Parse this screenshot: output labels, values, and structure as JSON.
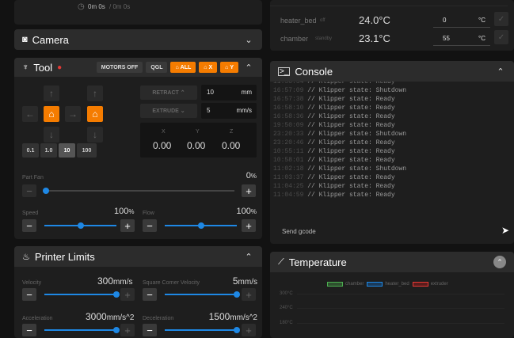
{
  "status": {
    "time": "0m 0s",
    "time_total": "/ 0m 0s"
  },
  "camera": {
    "title": "Camera"
  },
  "tool": {
    "title": "Tool",
    "motors_off": "MOTORS OFF",
    "qgl": "QGL",
    "home_all": "ALL",
    "home_x": "X",
    "home_y": "Y",
    "retract_label": "RETRACT",
    "extrude_label": "EXTRUDE",
    "retract_value": "10",
    "retract_unit": "mm",
    "extrude_value": "5",
    "extrude_unit": "mm/s",
    "axes": [
      {
        "label": "X",
        "value": "0.00"
      },
      {
        "label": "Y",
        "value": "0.00"
      },
      {
        "label": "Z",
        "value": "0.00"
      }
    ],
    "steps": [
      "0.1",
      "1.0",
      "10",
      "100"
    ],
    "active_step": "10",
    "part_fan_label": "Part Fan",
    "part_fan_value": "0",
    "part_fan_unit": "%",
    "speed_label": "Speed",
    "speed_value": "100",
    "speed_unit": "%",
    "flow_label": "Flow",
    "flow_value": "100",
    "flow_unit": "%",
    "part_fan_fraction": 0,
    "speed_fraction": 0.5,
    "flow_fraction": 0.5
  },
  "limits": {
    "title": "Printer Limits",
    "velocity_label": "Velocity",
    "velocity_value": "300",
    "velocity_unit": "mm/s",
    "scv_label": "Square Corner Velocity",
    "scv_value": "5",
    "scv_unit": "mm/s",
    "accel_label": "Acceleration",
    "accel_value": "3000",
    "accel_unit": "mm/s^2",
    "decel_label": "Deceleration",
    "decel_value": "1500",
    "decel_unit": "mm/s^2"
  },
  "heaters": [
    {
      "name": "heater_bed",
      "state": "off",
      "temp": "24.0°C",
      "target": "0",
      "unit": "°C"
    },
    {
      "name": "chamber",
      "state": "standby",
      "temp": "23.1°C",
      "target": "55",
      "unit": "°C"
    }
  ],
  "console": {
    "title": "Console",
    "placeholder": "Send gcode",
    "lines": [
      {
        "ts": "16:57:09",
        "msg": "// Klipper state: Shutdown"
      },
      {
        "ts": "16:57:38",
        "msg": "// Klipper state: Ready"
      },
      {
        "ts": "16:58:10",
        "msg": "// Klipper state: Ready"
      },
      {
        "ts": "16:58:36",
        "msg": "// Klipper state: Ready"
      },
      {
        "ts": "19:50:09",
        "msg": "// Klipper state: Ready"
      },
      {
        "ts": "23:20:33",
        "msg": "// Klipper state: Shutdown"
      },
      {
        "ts": "23:20:46",
        "msg": "// Klipper state: Ready"
      },
      {
        "ts": "10:55:11",
        "msg": "// Klipper state: Ready"
      },
      {
        "ts": "10:58:01",
        "msg": "// Klipper state: Ready"
      },
      {
        "ts": "11:02:18",
        "msg": "// Klipper state: Shutdown"
      },
      {
        "ts": "11:03:37",
        "msg": "// Klipper state: Ready"
      },
      {
        "ts": "11:04:25",
        "msg": "// Klipper state: Ready"
      },
      {
        "ts": "11:04:59",
        "msg": "// Klipper state: Ready"
      }
    ]
  },
  "temperature": {
    "title": "Temperature",
    "legend": [
      "chamber",
      "heater_bed",
      "extruder"
    ],
    "ticks": [
      "300°C",
      "240°C",
      "180°C"
    ],
    "legend_colors": [
      "#4caf50",
      "#1e88e5",
      "#e53935"
    ]
  },
  "colors": {
    "accent": "#f57c00",
    "slider": "#1e88e5"
  }
}
